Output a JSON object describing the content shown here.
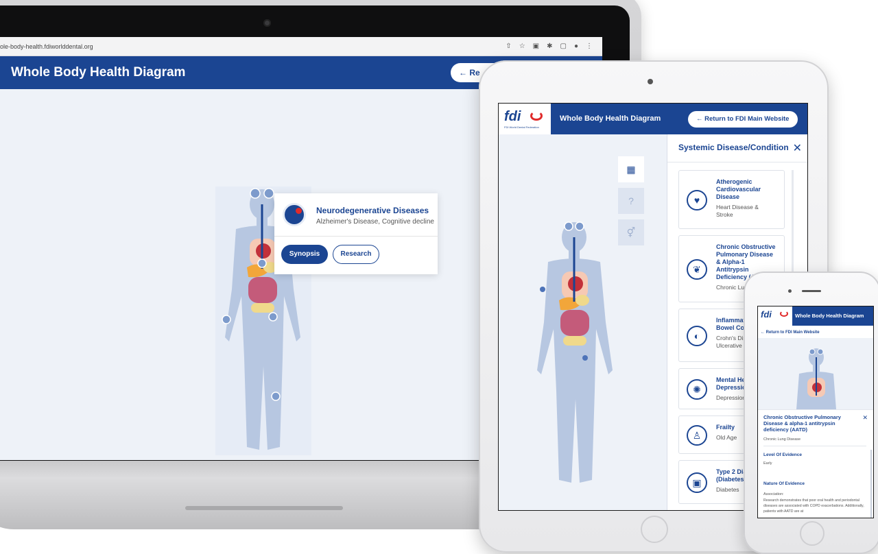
{
  "laptop": {
    "url": "ole-body-health.fdiworlddental.org",
    "header_title": "Whole Body Health Diagram",
    "return_label": "← Re",
    "popup": {
      "title": "Neurodegenerative Diseases",
      "subtitle": "Alzheimer's Disease, Cognitive decline",
      "synopsis_label": "Synopsis",
      "research_label": "Research"
    }
  },
  "tablet": {
    "logo_text": "fdi",
    "logo_sub": "FDI World Dental Federation",
    "header_title": "Whole Body Health Diagram",
    "return_label": "← Return to FDI Main Website",
    "panel_title": "Systemic Disease/Condition",
    "close_symbol": "✕",
    "tools": [
      "table-icon",
      "help-icon",
      "gender-icon"
    ],
    "cards": [
      {
        "title_lines": [
          "Atherogenic",
          "Cardiovascular",
          "Disease"
        ],
        "sub_lines": [
          "Heart Disease &",
          "Stroke"
        ],
        "icon": "heart-icon"
      },
      {
        "title_lines": [
          "Chronic Obstructive",
          "Pulmonary Disease",
          "& Alpha-1",
          "Antitrypsin",
          "Deficiency (A"
        ],
        "sub_lines": [
          "Chronic Lun"
        ],
        "icon": "lungs-icon"
      },
      {
        "title_lines": [
          "Inflammat",
          "Bowel Cor"
        ],
        "sub_lines": [
          "Crohn's Dis",
          "Ulcerative C"
        ],
        "icon": "stomach-icon"
      },
      {
        "title_lines": [
          "Mental He",
          "Depressio"
        ],
        "sub_lines": [
          "Depression"
        ],
        "icon": "brain-icon"
      },
      {
        "title_lines": [
          "Frailty"
        ],
        "sub_lines": [
          "Old Age"
        ],
        "icon": "elderly-icon"
      },
      {
        "title_lines": [
          "Type 2 Dia",
          "(Diabetes)"
        ],
        "sub_lines": [
          "Diabetes"
        ],
        "icon": "glucose-meter-icon"
      }
    ]
  },
  "phone": {
    "logo_text": "fdi",
    "header_title": "Whole Body Health Diagram",
    "return_label": "← Return to FDI Main Website",
    "detail_title": "Chronic Obstructive Pulmonary Disease & alpha-1 antitrypsin deficiency (AATD)",
    "detail_sub": "Chronic Lung Disease",
    "close_symbol": "✕",
    "level_heading": "Level Of Evidence",
    "level_value": "Early",
    "nature_heading": "Nature Of Evidence",
    "nature_label": "Association:",
    "nature_text": "Research demonstrates that poor oral health and periodontal diseases are associated with COPD exacerbations. Additionally, patients with AATD are at"
  },
  "colors": {
    "brand_blue": "#1b4592",
    "accent_red": "#e02b2b",
    "figure_fill": "#b7c7e1",
    "background": "#eef2f8"
  }
}
